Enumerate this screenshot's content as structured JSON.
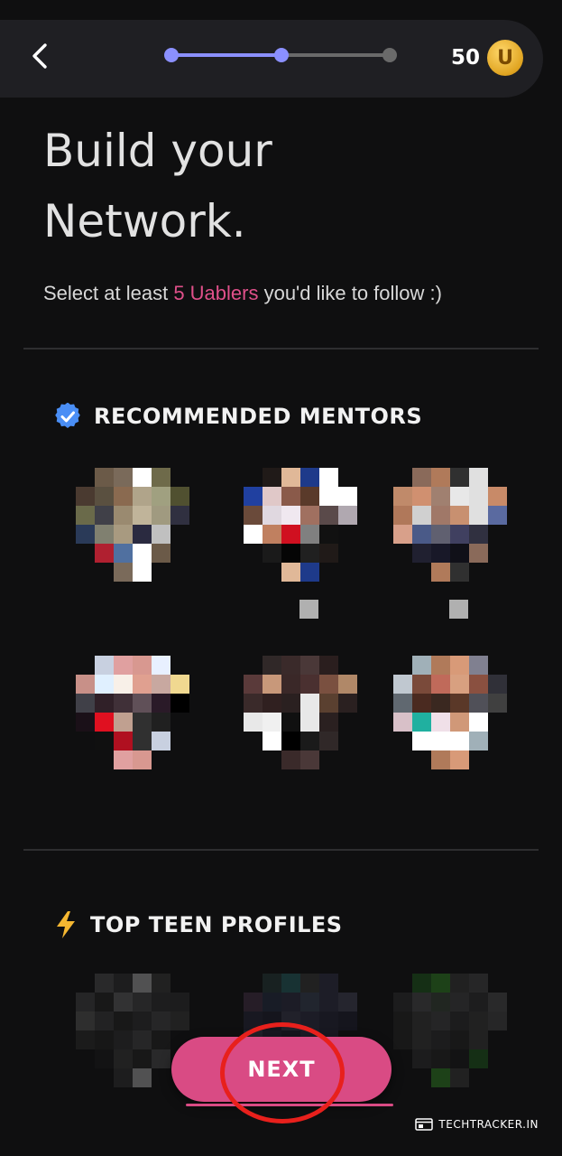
{
  "header": {
    "coin_count": "50",
    "coin_symbol": "U",
    "progress_step": 2,
    "progress_total": 3
  },
  "title_line1": "Build your",
  "title_line2": "Network.",
  "subtitle": {
    "prefix": "Select at least ",
    "highlight": "5 Uablers",
    "suffix": " you'd like to follow :)"
  },
  "sections": {
    "mentors": {
      "label": "RECOMMENDED MENTORS",
      "icon": "verified-check-icon"
    },
    "teens": {
      "label": "TOP TEEN PROFILES",
      "icon": "lightning-bolt-icon"
    }
  },
  "next_label": "NEXT",
  "watermark": "TECHTRACKER.IN",
  "colors": {
    "accent_pink": "#d94b84",
    "progress_active": "#8b90ff",
    "progress_inactive": "#6a6a6a",
    "coin_gold": "#e0a421",
    "annotation_red": "#e8201c"
  },
  "mentors_count": 6,
  "teens_visible_count": 3
}
